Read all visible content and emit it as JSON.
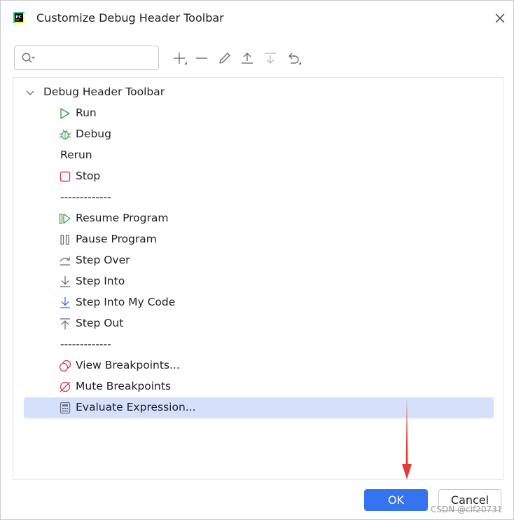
{
  "window": {
    "title": "Customize Debug Header Toolbar"
  },
  "search": {
    "value": "",
    "placeholder": ""
  },
  "toolbar": {
    "tools": [
      "add-icon",
      "remove-icon",
      "edit-icon",
      "move-up-icon",
      "move-down-icon",
      "restore-icon"
    ]
  },
  "tree": {
    "root_label": "Debug Header Toolbar",
    "items": [
      {
        "label": "Run",
        "icon": "run-icon"
      },
      {
        "label": "Debug",
        "icon": "debug-icon"
      },
      {
        "label": "Rerun",
        "icon": ""
      },
      {
        "label": "Stop",
        "icon": "stop-icon"
      },
      {
        "label": "-------------",
        "icon": ""
      },
      {
        "label": "Resume Program",
        "icon": "resume-icon"
      },
      {
        "label": "Pause Program",
        "icon": "pause-icon"
      },
      {
        "label": "Step Over",
        "icon": "step-over-icon"
      },
      {
        "label": "Step Into",
        "icon": "step-into-icon"
      },
      {
        "label": "Step Into My Code",
        "icon": "step-into-my-code-icon"
      },
      {
        "label": "Step Out",
        "icon": "step-out-icon"
      },
      {
        "label": "-------------",
        "icon": ""
      },
      {
        "label": "View Breakpoints...",
        "icon": "view-breakpoints-icon"
      },
      {
        "label": "Mute Breakpoints",
        "icon": "mute-breakpoints-icon"
      },
      {
        "label": "Evaluate Expression...",
        "icon": "calculator-icon",
        "selected": true
      }
    ]
  },
  "buttons": {
    "ok": "OK",
    "cancel": "Cancel"
  },
  "watermark": "CSDN @clf20731",
  "colors": {
    "accent": "#3574f0",
    "selection": "#d5e1fb",
    "run_green": "#3f9f4f",
    "stop_red": "#db3b4b",
    "annotation_arrow": "#e53935"
  }
}
